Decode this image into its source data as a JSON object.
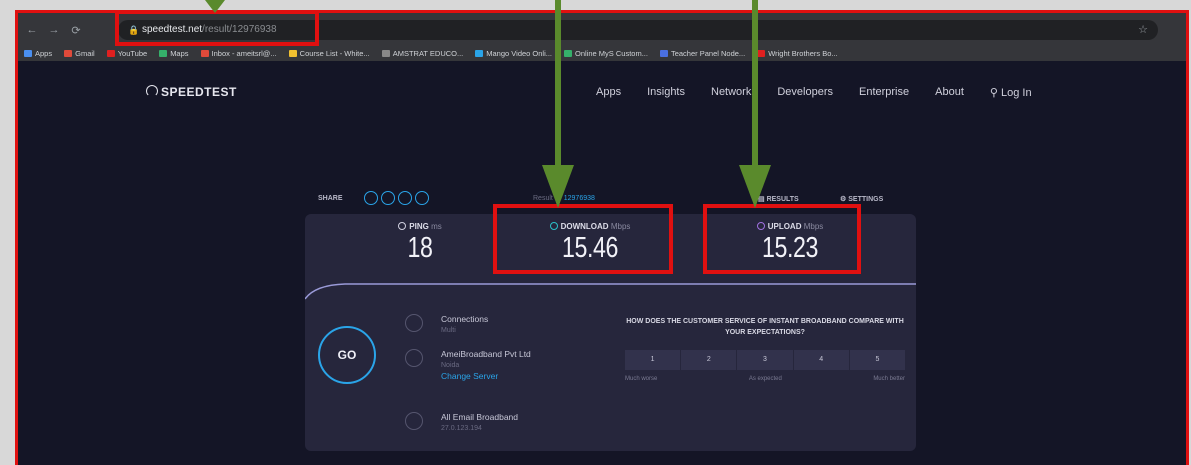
{
  "browser": {
    "url_host": "speedtest.net",
    "url_path": "/result/12976938",
    "bookmarks": [
      {
        "label": "Apps",
        "color": "#4a8ff0"
      },
      {
        "label": "Gmail",
        "color": "#e04a3a"
      },
      {
        "label": "YouTube",
        "color": "#e02020"
      },
      {
        "label": "Maps",
        "color": "#35b06a"
      },
      {
        "label": "Inbox - ameitsrl@...",
        "color": "#e04a3a"
      },
      {
        "label": "Course List - White...",
        "color": "#f0c030"
      },
      {
        "label": "AMSTRAT EDUCO...",
        "color": "#888888"
      },
      {
        "label": "Mango Video Onli...",
        "color": "#2aa4e8"
      },
      {
        "label": "Online MyS Custom...",
        "color": "#35b06a"
      },
      {
        "label": "Teacher Panel Node...",
        "color": "#4a6fe0"
      },
      {
        "label": "Wright Brothers Bo...",
        "color": "#e02020"
      }
    ]
  },
  "site": {
    "logo": "SPEEDTEST",
    "nav": [
      "Apps",
      "Insights",
      "Network",
      "Developers",
      "Enterprise",
      "About",
      "Log In"
    ]
  },
  "share": {
    "label": "SHARE",
    "result_prefix": "Result ID",
    "result_id": "12976938",
    "results_label": "RESULTS",
    "settings_label": "SETTINGS"
  },
  "metrics": {
    "ping": {
      "label": "PING",
      "unit": "ms",
      "value": "18"
    },
    "download": {
      "label": "DOWNLOAD",
      "unit": "Mbps",
      "value": "15.46"
    },
    "upload": {
      "label": "UPLOAD",
      "unit": "Mbps",
      "value": "15.23"
    }
  },
  "go_label": "GO",
  "connections": {
    "title": "Connections",
    "sub": "Multi"
  },
  "server": {
    "name": "AmeiBroadband Pvt Ltd",
    "location": "Noida",
    "change": "Change Server"
  },
  "isp": {
    "name": "All Email Broadband",
    "ip": "27.0.123.194"
  },
  "survey": {
    "question": "HOW DOES THE CUSTOMER SERVICE OF INSTANT BROADBAND COMPARE WITH YOUR EXPECTATIONS?",
    "scale": [
      "1",
      "2",
      "3",
      "4",
      "5"
    ],
    "low": "Much worse",
    "mid": "As expected",
    "high": "Much better"
  },
  "colors": {
    "annotation_red": "#e01010",
    "arrow_green": "#5a8a2c",
    "accent_blue": "#2aa4e8",
    "download_cyan": "#2ac0c8",
    "upload_purple": "#a070e0"
  }
}
